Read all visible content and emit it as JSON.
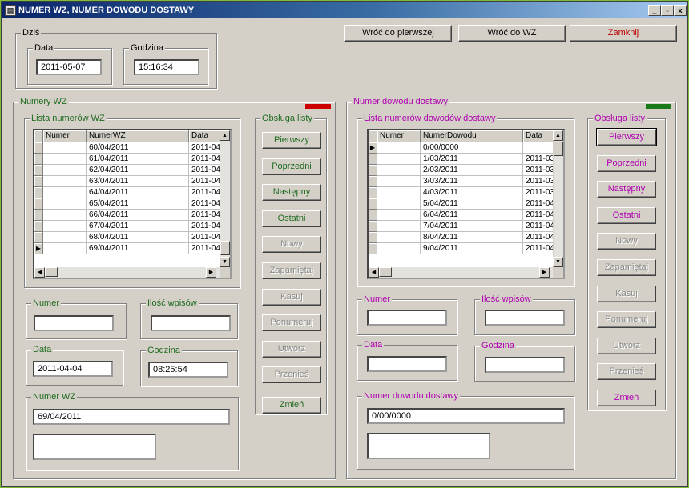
{
  "window": {
    "title": "NUMER WZ, NUMER DOWODU DOSTAWY",
    "min": "_",
    "max": "▫",
    "close": "x"
  },
  "today": {
    "legend": "Dziś",
    "date_legend": "Data",
    "date": "2011-05-07",
    "time_legend": "Godzina",
    "time": "15:16:34"
  },
  "top_buttons": {
    "first": "Wróć do pierwszej",
    "back_wz": "Wróć do WZ",
    "close": "Zamknij"
  },
  "left": {
    "legend": "Numery WZ",
    "flag_color": "#cc0000",
    "list_legend": "Lista numerów WZ",
    "columns": [
      "Numer",
      "NumerWZ",
      "Data"
    ],
    "rows": [
      [
        "",
        "60/04/2011",
        "2011-04-"
      ],
      [
        "",
        "61/04/2011",
        "2011-04-"
      ],
      [
        "",
        "62/04/2011",
        "2011-04-"
      ],
      [
        "",
        "63/04/2011",
        "2011-04-"
      ],
      [
        "",
        "64/04/2011",
        "2011-04-"
      ],
      [
        "",
        "65/04/2011",
        "2011-04-"
      ],
      [
        "",
        "66/04/2011",
        "2011-04-"
      ],
      [
        "",
        "67/04/2011",
        "2011-04-"
      ],
      [
        "",
        "68/04/2011",
        "2011-04-"
      ],
      [
        "",
        "69/04/2011",
        "2011-04-"
      ]
    ],
    "current_row": 9,
    "numer_legend": "Numer",
    "numer": "",
    "ilosc_legend": "Ilość wpisów",
    "ilosc": "",
    "data_legend": "Data",
    "data": "2011-04-04",
    "godzina_legend": "Godzina",
    "godzina": "08:25:54",
    "numerwz_legend": "Numer WZ",
    "numerwz": "69/04/2011",
    "extra": "",
    "ops_legend": "Obsługa listy",
    "ops": [
      "Pierwszy",
      "Poprzedni",
      "Następny",
      "Ostatni",
      "Nowy",
      "Zapamiętaj",
      "Kasuj",
      "Ponumeruj",
      "Utwórz",
      "Przenieś",
      "Zmień"
    ]
  },
  "right": {
    "legend": "Numer dowodu dostawy",
    "flag_color": "#1a7a1a",
    "list_legend": "Lista numerów dowodów dostawy",
    "columns": [
      "Numer",
      "NumerDowodu",
      "Data"
    ],
    "rows": [
      [
        "",
        "0/00/0000",
        ""
      ],
      [
        "",
        "1/03/2011",
        "2011-03-"
      ],
      [
        "",
        "2/03/2011",
        "2011-03-"
      ],
      [
        "",
        "3/03/2011",
        "2011-03-"
      ],
      [
        "",
        "4/03/2011",
        "2011-03-"
      ],
      [
        "",
        "5/04/2011",
        "2011-04-"
      ],
      [
        "",
        "6/04/2011",
        "2011-04-"
      ],
      [
        "",
        "7/04/2011",
        "2011-04-"
      ],
      [
        "",
        "8/04/2011",
        "2011-04-"
      ],
      [
        "",
        "9/04/2011",
        "2011-04-"
      ]
    ],
    "current_row": 0,
    "numer_legend": "Numer",
    "numer": "",
    "ilosc_legend": "Ilość wpisów",
    "ilosc": "",
    "data_legend": "Data",
    "data": "",
    "godzina_legend": "Godzina",
    "godzina": "",
    "dowod_legend": "Numer dowodu dostawy",
    "dowod": "0/00/0000",
    "extra": "",
    "ops_legend": "Obsługa listy",
    "ops": [
      "Pierwszy",
      "Poprzedni",
      "Następny",
      "Ostatni",
      "Nowy",
      "Zapamiętaj",
      "Kasuj",
      "Ponumeruj",
      "Utwórz",
      "Przenieś",
      "Zmień"
    ]
  },
  "icons": {
    "app": "app-icon",
    "row_pointer": "row-pointer-icon",
    "cursor": "mouse-cursor-icon"
  }
}
